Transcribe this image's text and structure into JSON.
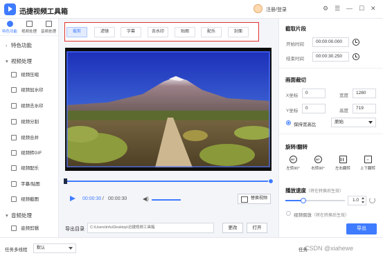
{
  "app": {
    "title": "迅捷视频工具箱",
    "login": "注册/登录"
  },
  "window_controls": {
    "settings": "⚙",
    "menu": "☰",
    "minimize": "—",
    "maximize": "☐",
    "close": "✕"
  },
  "sidebar": {
    "categories": [
      {
        "label": "特色功能",
        "icon": "star-icon",
        "active": true
      },
      {
        "label": "视频处理",
        "icon": "video-icon",
        "active": false
      },
      {
        "label": "音频处理",
        "icon": "audio-icon",
        "active": false
      }
    ],
    "section_feature": {
      "arrow": "›",
      "label": "特色功能"
    },
    "section_video": {
      "arrow": "▾",
      "label": "视频处理"
    },
    "video_items": [
      {
        "label": "视频压缩",
        "icon": "compress-icon"
      },
      {
        "label": "视频加水印",
        "icon": "watermark-add-icon"
      },
      {
        "label": "视频去水印",
        "icon": "watermark-remove-icon"
      },
      {
        "label": "视频分割",
        "icon": "split-icon"
      },
      {
        "label": "视频合并",
        "icon": "merge-icon"
      },
      {
        "label": "视频转GIF",
        "icon": "gif-icon"
      },
      {
        "label": "视频配乐",
        "icon": "music-icon"
      },
      {
        "label": "字幕/贴图",
        "icon": "subtitle-icon"
      },
      {
        "label": "视频截图",
        "icon": "screenshot-icon"
      }
    ],
    "section_audio": {
      "arrow": "▾",
      "label": "音频处理"
    },
    "audio_items": [
      {
        "label": "音频剪辑",
        "icon": "audio-cut-icon"
      }
    ]
  },
  "editor": {
    "tabs": [
      "裁剪",
      "滤镜",
      "字幕",
      "去水印",
      "贴图",
      "配乐",
      "封面"
    ],
    "active_tab": "裁剪",
    "player": {
      "current_time": "00:00:30",
      "separator": "/",
      "total_time": "00:00:30",
      "replace_label": "替换视频"
    }
  },
  "export": {
    "label": "导出目录",
    "path": "C:\\Users\\lnfu\\Desktop\\迅捷视频工具箱",
    "change_label": "更改",
    "open_label": "打开",
    "button_label": "导出"
  },
  "right_panel": {
    "clip": {
      "title": "截取片段",
      "start_label": "开始时间",
      "start_value": "00:00:00.000",
      "end_label": "结束时间",
      "end_value": "00:00:30.250"
    },
    "crop": {
      "title": "画面裁切",
      "x_label": "X坐标",
      "x_value": "0",
      "width_label": "宽度",
      "width_value": "1280",
      "y_label": "Y坐标",
      "y_value": "0",
      "height_label": "高度",
      "height_value": "719",
      "keep_ratio_label": "保持宽高比",
      "keep_ratio_checked": true,
      "ratio_value": "原始"
    },
    "rotate": {
      "title": "旋转/翻转",
      "items": [
        {
          "label": "左转90°",
          "icon": "rotate-left-icon",
          "glyph": "90°"
        },
        {
          "label": "右转90°",
          "icon": "rotate-right-icon",
          "glyph": "90°"
        },
        {
          "label": "左右翻转",
          "icon": "flip-horizontal-icon",
          "glyph": "▍▍"
        },
        {
          "label": "上下翻转",
          "icon": "flip-vertical-icon",
          "glyph": "═"
        }
      ]
    },
    "speed": {
      "title": "播放速度",
      "note": "（将在转换后生效）",
      "value": "1.0",
      "reverse_label": "视频倒放",
      "reverse_note": "（将在转换后生效）",
      "level_fraction": 0.3
    }
  },
  "statusbar": {
    "task_label": "任务多线程",
    "task_value": "默认",
    "right_text": "任务",
    "watermark": "CSDN @xiahewe"
  },
  "colors": {
    "accent": "#3e7bff",
    "highlight_border": "#e0312f"
  }
}
